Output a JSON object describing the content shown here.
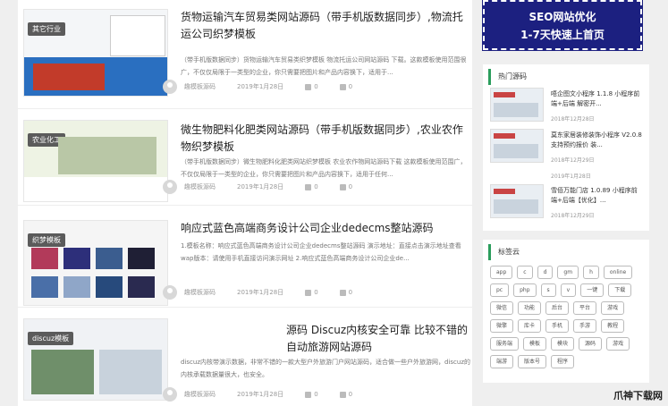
{
  "posts": [
    {
      "tag": "其它行业",
      "title": "货物运输汽车贸易类网站源码（带手机版数据同步）,物流托运公司织梦模板",
      "desc": "（带手机版数据同步）货物运输汽车贸易类织梦模板 物流托运公司网站源码 下载。这款模板使用范围很广，不仅仅局限于一类型的企业，你只需要把图片和产品内容换下，适用于...",
      "author": "趣模板源码",
      "date": "2019年1月28日",
      "likes": "0",
      "comments": "0"
    },
    {
      "tag": "农业化工",
      "title": "微生物肥料化肥类网站源码（带手机版数据同步）,农业农作物织梦模板",
      "desc": "（带手机版数据同步）微生物肥料化肥类网站织梦模板 农业农作物网站源码下载 这款模板使用范围广，不仅仅局限于一类型的企业，你只需要把图片和产品内容换下，适用于任何...",
      "author": "趣模板源码",
      "date": "2019年1月28日",
      "likes": "0",
      "comments": "0"
    },
    {
      "tag": "织梦模板",
      "title": "响应式蓝色高端商务设计公司企业dedecms整站源码",
      "desc": "1.模板名称：响应式蓝色高端商务设计公司企业dedecms整站源码 演示地址：直接点击演示地址查看 wap版本：请使用手机直接访问演示网址 2.响应式蓝色高端商务设计公司企业de...",
      "author": "趣模板源码",
      "date": "2019年1月28日",
      "likes": "0",
      "comments": "0"
    },
    {
      "tag": "discuz模板",
      "title": "源码 Discuz内核安全可靠 比较不错的自动旅游网站源码",
      "desc": "discuz内核带演示数据，非常不错的一款大型户外旅游门户网站源码，适合做一些户外旅游网，discuz的内核承载数据量很大，也安全。",
      "author": "趣模板源码",
      "date": "2019年1月28日",
      "likes": "0",
      "comments": "0"
    }
  ],
  "banner": {
    "line1": "SEO网站优化",
    "line2": "1-7天快速上首页"
  },
  "hot": {
    "title": "热门源码",
    "items": [
      {
        "title": "唔企图文小程序 1.1.8 小程序前端+后端 解密开...",
        "date": "2018年12月28日"
      },
      {
        "title": "莫东家居装修装饰小程序 V2.0.8 支持预约报价 装...",
        "date": "2018年12月29日"
      },
      {
        "title": "雪佰万能门店 1.0.89 小程序前端+后端【优化】...",
        "date": "2018年12月29日"
      }
    ],
    "extra_date": "2019年1月28日"
  },
  "tagcloud": {
    "title": "标签云",
    "tags": [
      "app",
      "c",
      "d",
      "gm",
      "h",
      "online",
      "pc",
      "php",
      "s",
      "v",
      "一键",
      "下载",
      "微信",
      "功能",
      "后台",
      "平台",
      "游戏",
      "微擎",
      "库卡",
      "手机",
      "手游",
      "教程",
      "服务端",
      "模板",
      "模块",
      "源码",
      "游戏",
      "端游",
      "版本号",
      "程序"
    ]
  },
  "watermark": "爪神下载网"
}
